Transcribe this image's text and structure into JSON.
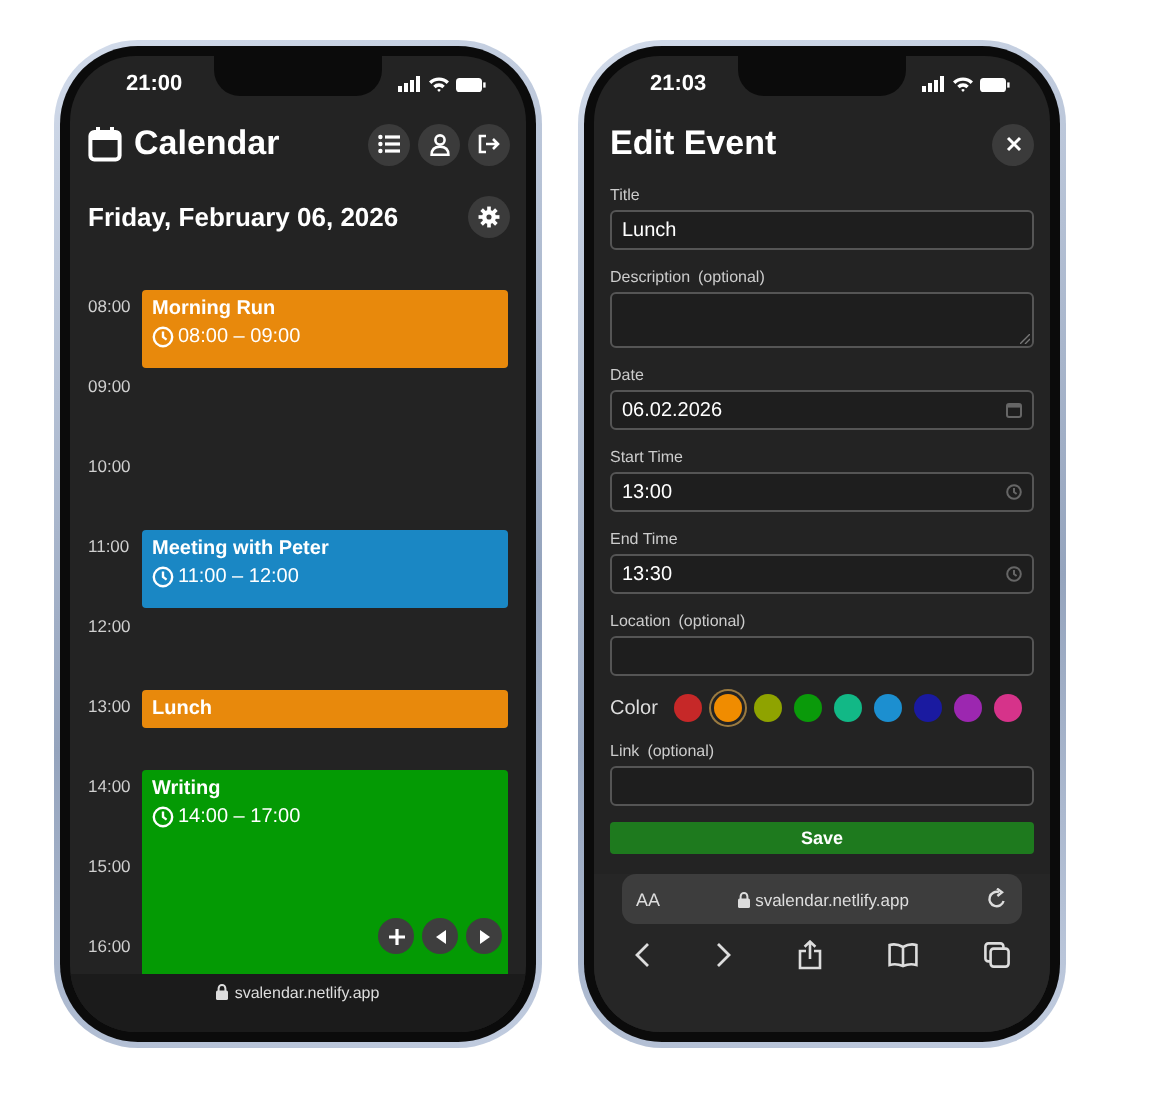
{
  "calendar_screen": {
    "status_time": "21:00",
    "title": "Calendar",
    "date": "Friday, February 06, 2026",
    "hours": [
      {
        "label": "08:00",
        "event": {
          "title": "Morning Run",
          "time": "08:00 – 09:00",
          "kind": "hour",
          "color": "#e8890c"
        }
      },
      {
        "label": "09:00"
      },
      {
        "label": "10:00"
      },
      {
        "label": "11:00",
        "event": {
          "title": "Meeting with Peter",
          "time": "11:00 – 12:00",
          "kind": "hour",
          "color": "#1a87c4"
        }
      },
      {
        "label": "12:00"
      },
      {
        "label": "13:00",
        "event": {
          "title": "Lunch",
          "kind": "half_hour",
          "color": "#e8890c"
        }
      },
      {
        "label": "14:00",
        "event": {
          "title": "Writing",
          "time": "14:00 – 17:00",
          "kind": "three_hours",
          "color": "#049a04"
        }
      },
      {
        "label": "15:00"
      },
      {
        "label": "16:00"
      }
    ],
    "url": "svalendar.netlify.app"
  },
  "edit_screen": {
    "status_time": "21:03",
    "title": "Edit Event",
    "form": [
      {
        "kind": "text",
        "label": "Title",
        "value": "Lunch"
      },
      {
        "kind": "textarea",
        "label": "Description",
        "optional": "(optional)"
      },
      {
        "kind": "date",
        "label": "Date",
        "value": "06.02.2026"
      },
      {
        "kind": "time",
        "label": "Start Time",
        "value": "13:00"
      },
      {
        "kind": "time",
        "label": "End Time",
        "value": "13:30"
      },
      {
        "kind": "text",
        "label": "Location",
        "optional": "(optional)"
      },
      {
        "kind": "colors",
        "label": "Color",
        "swatches": [
          {
            "color": "#c62828",
            "selected": false
          },
          {
            "color": "#f08c00",
            "selected": true
          },
          {
            "color": "#8fa300",
            "selected": false
          },
          {
            "color": "#0a9a0a",
            "selected": false
          },
          {
            "color": "#12b886",
            "selected": false
          },
          {
            "color": "#1c8fd0",
            "selected": false
          },
          {
            "color": "#1a1aa0",
            "selected": false
          },
          {
            "color": "#9c27b0",
            "selected": false
          },
          {
            "color": "#d6338a",
            "selected": false
          }
        ]
      },
      {
        "kind": "text",
        "label": "Link",
        "optional": "(optional)"
      }
    ],
    "save_label": "Save",
    "browser": {
      "text_size": "AA",
      "url": "svalendar.netlify.app"
    }
  }
}
